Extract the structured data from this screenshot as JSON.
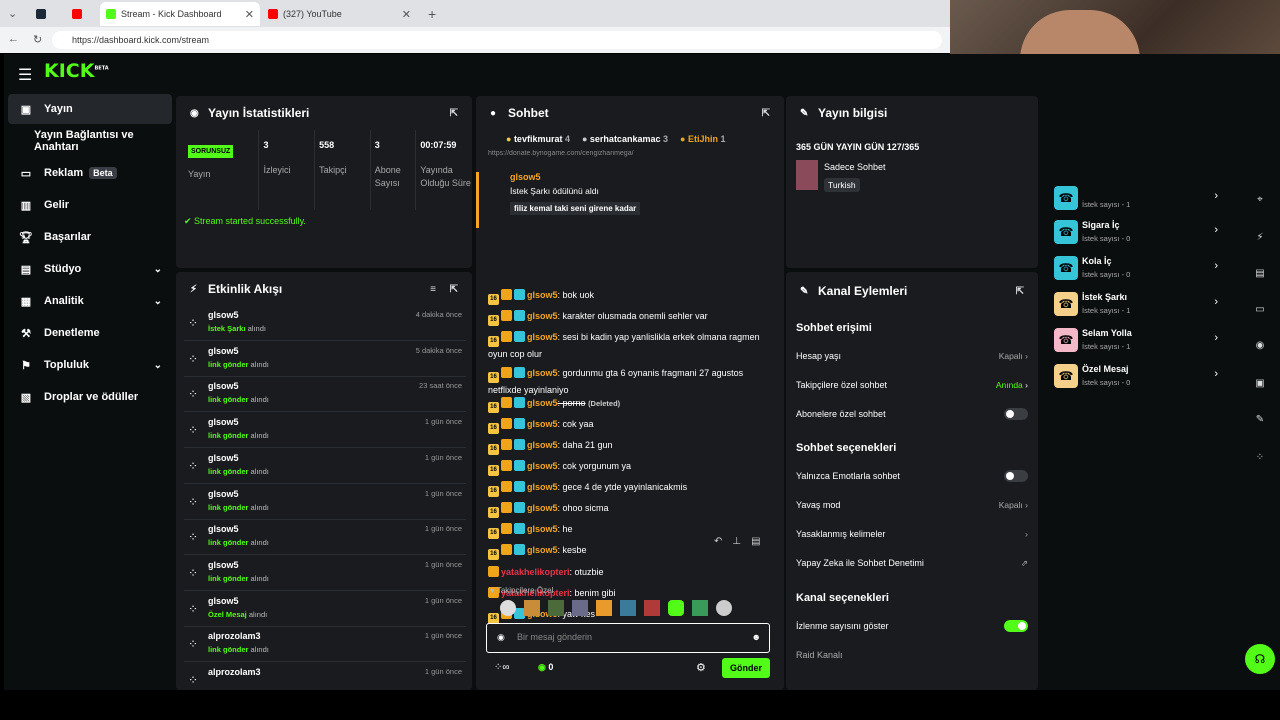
{
  "browser": {
    "tabs": [
      {
        "label": "",
        "icon": "steam-icon"
      },
      {
        "label": "",
        "icon": "youtube-icon"
      },
      {
        "label": "Stream - Kick Dashboard",
        "icon": "kick-icon"
      },
      {
        "label": "(327) YouTube",
        "icon": "youtube-icon"
      }
    ],
    "url": "https://dashboard.kick.com/stream"
  },
  "app": {
    "logo": "KICK",
    "logo_badge": "BETA",
    "sidebar": [
      {
        "label": "Yayın",
        "icon": "broadcast-icon",
        "active": true
      },
      {
        "label": "Yayın Bağlantısı ve Anahtarı",
        "icon": "",
        "active": false
      },
      {
        "label": "Reklam",
        "icon": "ad-icon",
        "badge": "Beta"
      },
      {
        "label": "Gelir",
        "icon": "revenue-icon"
      },
      {
        "label": "Başarılar",
        "icon": "trophy-icon"
      },
      {
        "label": "Stüdyo",
        "icon": "studio-icon",
        "chevron": true
      },
      {
        "label": "Analitik",
        "icon": "analytics-icon",
        "chevron": true
      },
      {
        "label": "Denetleme",
        "icon": "moderation-icon"
      },
      {
        "label": "Topluluk",
        "icon": "community-icon",
        "chevron": true
      },
      {
        "label": "Droplar ve ödüller",
        "icon": "drops-icon"
      }
    ]
  },
  "stats": {
    "title": "Yayın İstatistikleri",
    "status": "SORUNSUZ",
    "status_label": "Yayın",
    "viewers": "3",
    "viewers_label": "İzleyici",
    "followers": "558",
    "followers_label": "Takipçi",
    "subs": "3",
    "subs_label": "Abone Sayısı",
    "uptime": "00:07:59",
    "uptime_label": "Yayında Olduğu Süre",
    "message": "Stream started successfully."
  },
  "feed": {
    "title": "Etkinlik Akışı",
    "rows": [
      {
        "user": "glsow5",
        "item": "İstek Şarkı",
        "suffix": "alındı",
        "time": "4 dakika önce"
      },
      {
        "user": "glsow5",
        "item": "link gönder",
        "suffix": "alındı",
        "time": "5 dakika önce"
      },
      {
        "user": "glsow5",
        "item": "link gönder",
        "suffix": "alındı",
        "time": "23 saat önce"
      },
      {
        "user": "glsow5",
        "item": "link gönder",
        "suffix": "alındı",
        "time": "1 gün önce"
      },
      {
        "user": "glsow5",
        "item": "link gönder",
        "suffix": "alındı",
        "time": "1 gün önce"
      },
      {
        "user": "glsow5",
        "item": "link gönder",
        "suffix": "alındı",
        "time": "1 gün önce"
      },
      {
        "user": "glsow5",
        "item": "link gönder",
        "suffix": "alındı",
        "time": "1 gün önce"
      },
      {
        "user": "glsow5",
        "item": "link gönder",
        "suffix": "alındı",
        "time": "1 gün önce"
      },
      {
        "user": "glsow5",
        "item": "Özel Mesaj",
        "suffix": "alındı",
        "time": "1 gün önce"
      },
      {
        "user": "alprozolam3",
        "item": "link gönder",
        "suffix": "alındı",
        "time": "1 gün önce"
      },
      {
        "user": "alprozolam3",
        "item": "",
        "suffix": "",
        "time": "1 gün önce"
      }
    ]
  },
  "chat": {
    "title": "Sohbet",
    "top": [
      {
        "name": "tevfikmurat",
        "count": "4"
      },
      {
        "name": "serhatcankamac",
        "count": "3"
      },
      {
        "name": "EtiJhin",
        "count": "1"
      }
    ],
    "partial_link": "https://donate.bynogame.com/cengizhanmega/",
    "reward_user": "glsow5",
    "reward_text": "İstek Şarkı ödülünü aldı",
    "reward_msg": "filiz kemal taki seni girene kadar",
    "messages": [
      {
        "user": "glsow5",
        "text": ": bok uok",
        "style": "sub"
      },
      {
        "user": "glsow5",
        "text": ": karakter olusmada onemli sehler var",
        "style": "sub"
      },
      {
        "user": "glsow5",
        "text": ": sesi bi kadin yap yanlislikla erkek olmana ragmen oyun cop olur",
        "style": "sub"
      },
      {
        "user": "glsow5",
        "text": ": gordunmu gta 6 oynanis fragmani 27 agustos netflixde yayinlaniyo",
        "style": "sub"
      },
      {
        "user": "glsow5",
        "text": ": porno",
        "style": "del",
        "extra": "(Deleted)"
      },
      {
        "user": "glsow5",
        "text": ": cok yaa",
        "style": "sub"
      },
      {
        "user": "glsow5",
        "text": ": daha 21 gun",
        "style": "sub"
      },
      {
        "user": "glsow5",
        "text": ": cok yorgunum ya",
        "style": "sub"
      },
      {
        "user": "glsow5",
        "text": ": gece 4 de ytde yayinlanicakmis",
        "style": "sub"
      },
      {
        "user": "glsow5",
        "text": ": ohoo sicma",
        "style": "sub"
      },
      {
        "user": "glsow5",
        "text": ": he",
        "style": "sub"
      },
      {
        "user": "glsow5",
        "text": ": kesbe",
        "style": "sub"
      },
      {
        "user": "yatakhelikopteri",
        "text": ": otuzbie",
        "style": "crown"
      },
      {
        "user": "yatakhelikopteri",
        "text": ": benim gibi",
        "style": "crown"
      },
      {
        "user": "glsow5",
        "text": ": yaw kes",
        "style": "sub"
      }
    ],
    "emote_label": "Takipçilere Özel",
    "input_placeholder": "Bir mesaj gönderin",
    "points": "0",
    "send": "Gönder"
  },
  "info": {
    "title": "Yayın bilgisi",
    "stream_title": "365 GÜN YAYIN GÜN 127/365",
    "category": "Sadece Sohbet",
    "language": "Turkish"
  },
  "actions": {
    "title": "Kanal Eylemleri",
    "sec1": "Sohbet erişimi",
    "account_age": "Hesap yaşı",
    "account_age_val": "Kapalı",
    "followers_only": "Takipçilere özel sohbet",
    "followers_only_val": "Anında",
    "subs_only": "Abonelere özel sohbet",
    "sec2": "Sohbet seçenekleri",
    "emote_only": "Yalnızca Emotlarla sohbet",
    "slow_mode": "Yavaş mod",
    "slow_mode_val": "Kapalı",
    "banned_words": "Yasaklanmış kelimeler",
    "ai_mod": "Yapay Zeka ile Sohbet Denetimi",
    "sec3": "Kanal seçenekleri",
    "show_viewers": "İzlenme sayısını göster",
    "raid": "Raid Kanalı"
  },
  "rewards": [
    {
      "name": "",
      "count": "İstek sayısı - 1",
      "color": "#36c4d9"
    },
    {
      "name": "Sigara İç",
      "count": "İstek sayısı - 0",
      "color": "#36c4d9"
    },
    {
      "name": "Kola İç",
      "count": "İstek sayısı - 0",
      "color": "#36c4d9"
    },
    {
      "name": "İstek Şarkı",
      "count": "İstek sayısı - 1",
      "color": "#f5d08a"
    },
    {
      "name": "Selam Yolla",
      "count": "İstek sayısı - 1",
      "color": "#f5b8c8"
    },
    {
      "name": "Özel Mesaj",
      "count": "İstek sayısı - 0",
      "color": "#f5d08a"
    }
  ]
}
